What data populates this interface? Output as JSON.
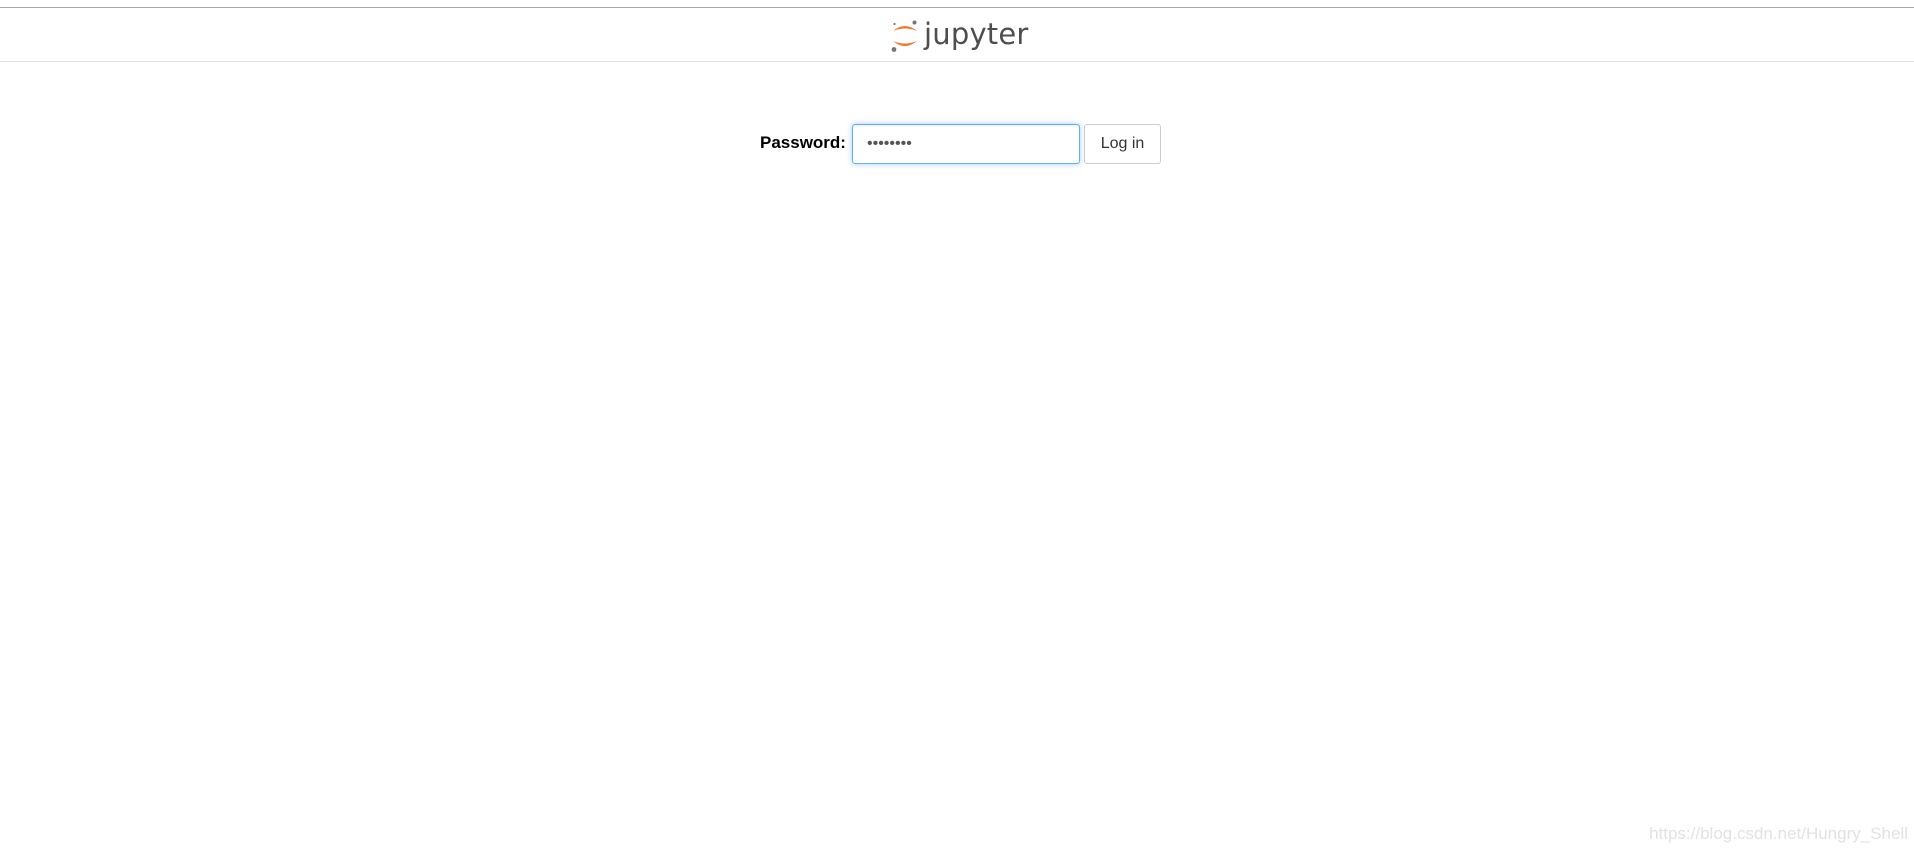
{
  "header": {
    "logo_text": "jupyter",
    "logo_icon": "jupyter-logo-icon"
  },
  "login": {
    "password_label": "Password:",
    "password_value": "••••••••",
    "button_label": "Log in"
  },
  "watermark": {
    "text": "https://blog.csdn.net/Hungry_Shell"
  },
  "colors": {
    "logo_orange": "#f37726",
    "logo_gray": "#767677",
    "logo_text": "#4e4e4e",
    "focus_border": "#66afe9"
  }
}
